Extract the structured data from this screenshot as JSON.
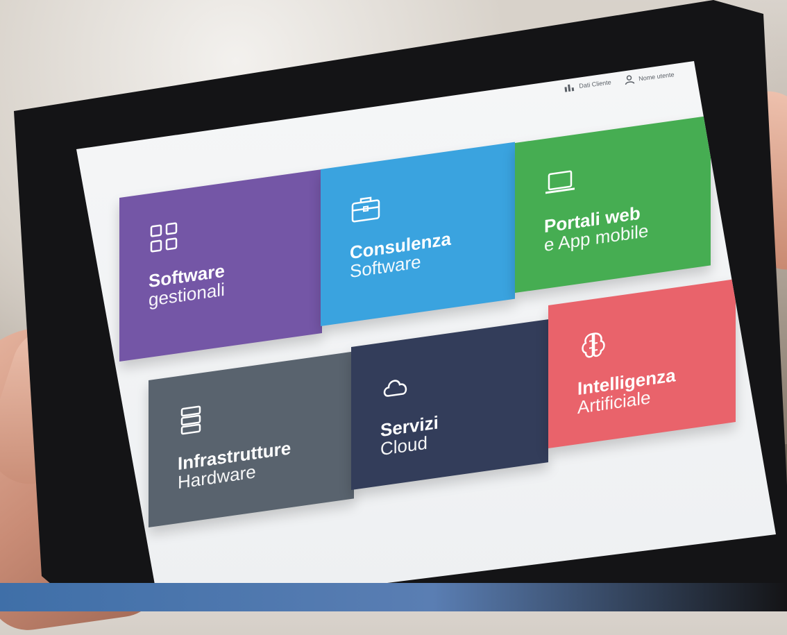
{
  "topbar": {
    "clients_label": "Dati Cliente",
    "user_label": "Nome utente"
  },
  "tiles": [
    {
      "title": "Software",
      "subtitle": "gestionali",
      "icon": "grid-icon",
      "color": "#7456a6"
    },
    {
      "title": "Consulenza",
      "subtitle": "Software",
      "icon": "briefcase-icon",
      "color": "#3aa3df"
    },
    {
      "title": "Portali web",
      "subtitle": "e App mobile",
      "icon": "laptop-icon",
      "color": "#46ad52"
    },
    {
      "title": "Infrastrutture",
      "subtitle": "Hardware",
      "icon": "server-icon",
      "color": "#59636e"
    },
    {
      "title": "Servizi",
      "subtitle": "Cloud",
      "icon": "cloud-icon",
      "color": "#333d5a"
    },
    {
      "title": "Intelligenza",
      "subtitle": "Artificiale",
      "icon": "brain-icon",
      "color": "#e9636b"
    }
  ]
}
